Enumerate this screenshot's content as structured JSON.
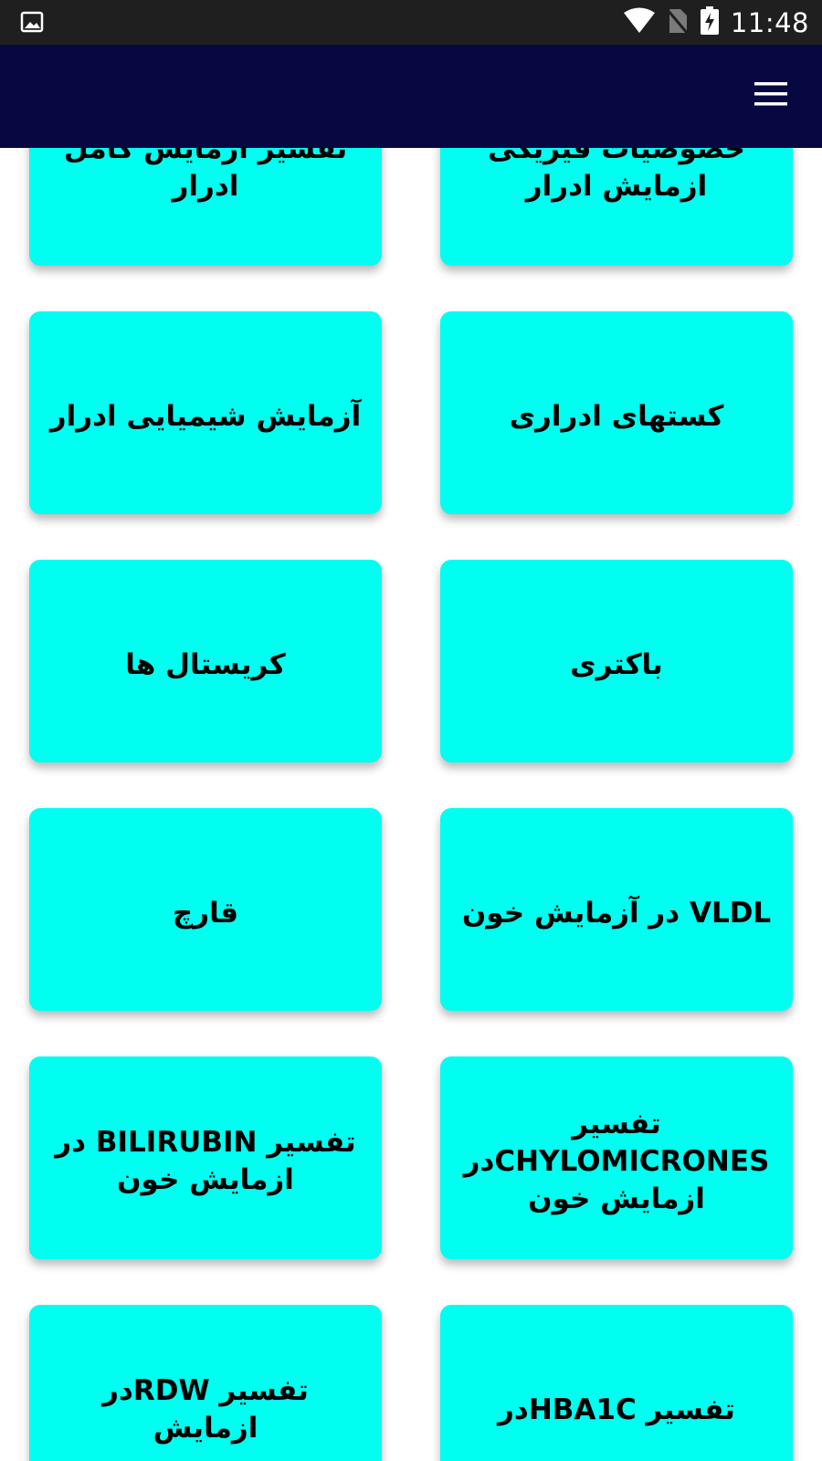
{
  "status_bar": {
    "time": "11:48",
    "icons": [
      "image-icon",
      "wifi-icon",
      "no-sim-icon",
      "battery-charging-icon"
    ]
  },
  "app_bar": {
    "menu_icon": "hamburger-menu-icon"
  },
  "cards": [
    {
      "label": "خصوصیات فیزیکی\nازمایش ادرار"
    },
    {
      "label": "تفسیر آزمایش کامل\nادرار"
    },
    {
      "label": "کستهای ادراری"
    },
    {
      "label": "آزمایش شیمیایی ادرار"
    },
    {
      "label": "باکتری"
    },
    {
      "label": "کریستال ها"
    },
    {
      "label": "VLDL در آزمایش خون"
    },
    {
      "label": "قارچ"
    },
    {
      "label": "تفسیر\nCHYLOMICRONESدر\nازمایش خون"
    },
    {
      "label": "تفسیر BILIRUBIN در\nازمایش خون"
    },
    {
      "label": "تفسیر HBA1Cدر"
    },
    {
      "label": "تفسیر RDWدر ازمایش"
    }
  ],
  "colors": {
    "status_bar": "#1f1f1f",
    "app_bar": "#070742",
    "card": "#00fff0"
  }
}
